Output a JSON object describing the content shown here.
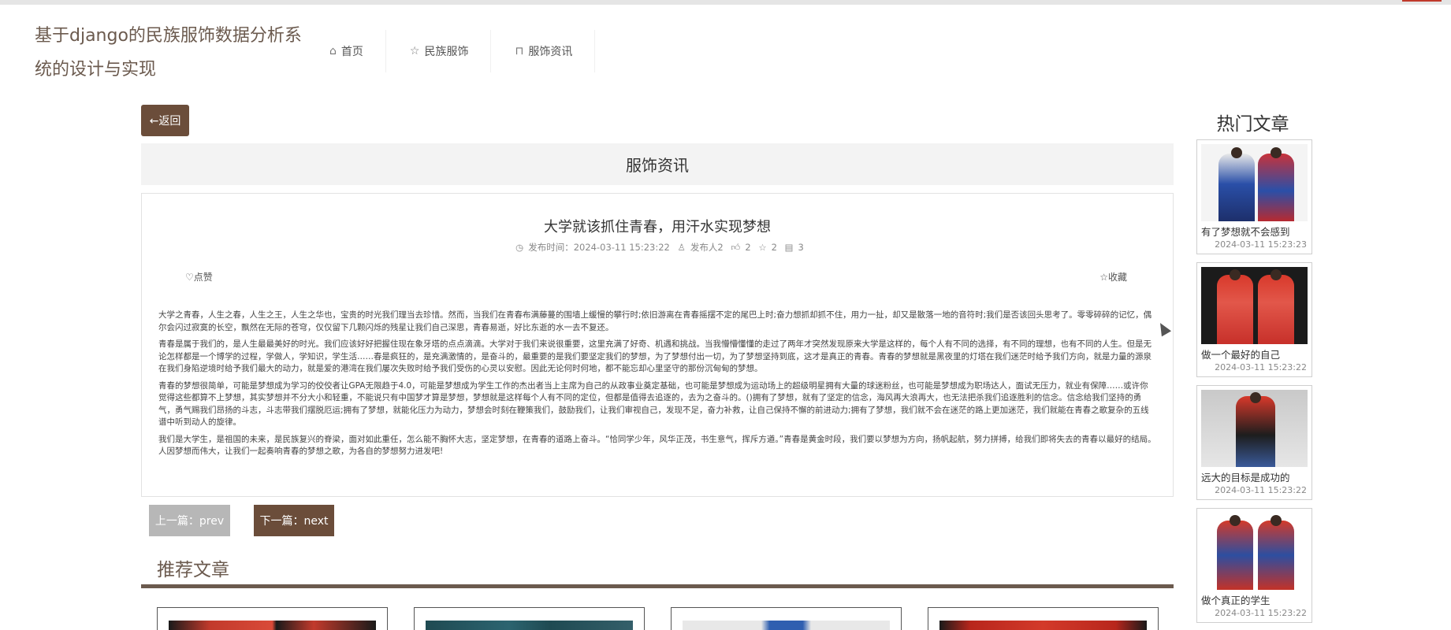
{
  "site": {
    "title": "基于django的民族服饰数据分析系统的设计与实现"
  },
  "nav": {
    "items": [
      {
        "label": "首页",
        "icon": "home-icon"
      },
      {
        "label": "民族服饰",
        "icon": "star-icon"
      },
      {
        "label": "服饰资讯",
        "icon": "bag-icon"
      }
    ]
  },
  "back": {
    "label": "←返回"
  },
  "section": {
    "title": "服饰资讯"
  },
  "article": {
    "title": "大学就该抓住青春，用汗水实现梦想",
    "publish_label": "发布时间：2024-03-11 15:23:22",
    "author": "发布人2",
    "likes": "2",
    "favorites": "2",
    "comments": "3",
    "like_label": "点赞",
    "collect_label": "收藏",
    "paragraphs": [
      "大学之青春，人生之春，人生之王，人生之华也，宝贵的时光我们理当去珍惜。然而，当我们在青春布满藤蔓的围墙上缓慢的攀行时;依旧游离在青春摇摆不定的尾巴上时;奋力想抓却抓不住，用力一扯，却又是散落一地的音符时;我们是否该回头思考了。零零碎碎的记忆，偶尔会闪过寂寞的长空，飘然在无际的苍穹，仅仅留下几颗闪烁的残星让我们自己深思，青春易逝，好比东逝的水一去不复还。",
      "青春是属于我们的，是人生最最美好的时光。我们应该好好把握住现在象牙塔的点点滴滴。大学对于我们来说很重要，这里充满了好奇、机遇和挑战。当我懵懵懂懂的走过了两年才突然发现原来大学是这样的，每个人有不同的选择，有不同的理想，也有不同的人生。但是无论怎样都是一个博学的过程，学做人，学知识，学生活……春是疯狂的，是充满激情的，是奋斗的，最重要的是我们要坚定我们的梦想，为了梦想付出一切，为了梦想坚持到底，这才是真正的青春。青春的梦想就是黑夜里的灯塔在我们迷茫时给予我们方向，就是力量的源泉在我们身陷逆境时给予我们最大的动力，就是爱的港湾在我们屡次失败时给予我们受伤的心灵以安慰。因此无论何时何地，都不能忘却心里坚守的那份沉甸甸的梦想。",
      "青春的梦想很简单，可能是梦想成为学习的佼佼者让GPA无限趋于4.0，可能是梦想成为学生工作的杰出者当上主席为自己的从政事业奠定基础，也可能是梦想成为运动场上的超级明星拥有大量的球迷粉丝，也可能是梦想成为职场达人，面试无压力，就业有保障……或许你觉得这些都算不上梦想，其实梦想并不分大小和轻重，不能说只有中国梦才算是梦想，梦想就是这样每个人有不同的定位，但都是值得去追逐的，去为之奋斗的。()拥有了梦想，就有了坚定的信念，海风再大浪再大，也无法把杀我们追逐胜利的信念。信念给我们坚持的勇气，勇气赐我们昂扬的斗志，斗志带我们摆脱厄运;拥有了梦想，就能化压力为动力，梦想会时刻在鞭策我们，鼓励我们，让我们审视自己，发现不足，奋力补救，让自己保持不懈的前进动力;拥有了梦想，我们就不会在迷茫的路上更加迷茫，我们就能在青春之歌复杂的五线谱中听到动人的旋律。",
      "我们是大学生，是祖国的未来，是民族复兴的脊梁，面对如此重任，怎么能不胸怀大志，坚定梦想，在青春的道路上奋斗。“恰同学少年，风华正茂，书生意气，挥斥方遒。”青春是黄金时段，我们要以梦想为方向，扬帆起航，努力拼搏，给我们即将失去的青春以最好的结局。人因梦想而伟大，让我们一起奏响青春的梦想之歌，为各自的梦想努力进发吧!"
    ]
  },
  "pager": {
    "prev": "上一篇：prev",
    "next": "下一篇：next"
  },
  "recommend": {
    "title": "推荐文章"
  },
  "hot": {
    "title": "热门文章",
    "items": [
      {
        "name": "有了梦想就不会感到",
        "time": "2024-03-11 15:23:23"
      },
      {
        "name": "做一个最好的自己",
        "time": "2024-03-11 15:23:22"
      },
      {
        "name": "远大的目标是成功的",
        "time": "2024-03-11 15:23:22"
      },
      {
        "name": "做个真正的学生",
        "time": "2024-03-11 15:23:22"
      }
    ]
  },
  "colors": {
    "brand": "#6b4d3a",
    "title_text": "#6b5a4e",
    "prev_disabled": "#b7b7b7",
    "header_bg": "#f3f3f3"
  }
}
